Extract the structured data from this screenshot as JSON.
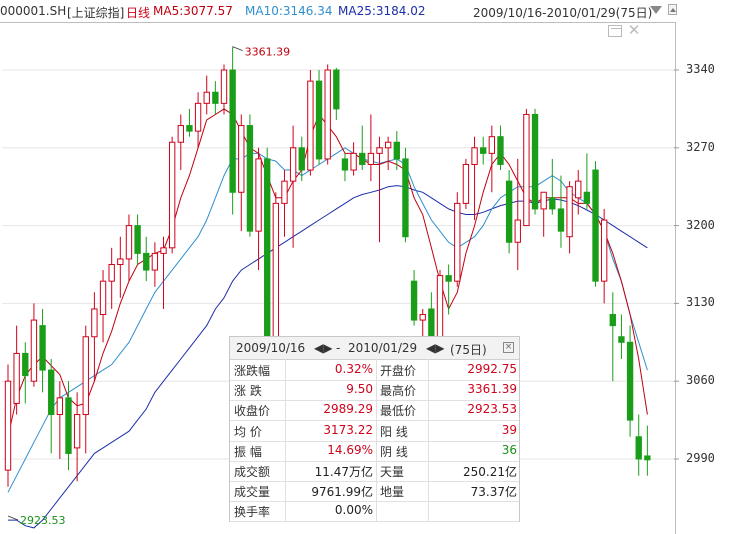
{
  "header": {
    "code": "000001.SH",
    "name": "[上证综指]",
    "period": "日线",
    "ma5": "MA5:3077.57",
    "ma10": "MA10:3146.34",
    "ma25": "MA25:3184.02",
    "range": "2009/10/16-2010/01/29(75日)"
  },
  "colors": {
    "up": "#d0021b",
    "down": "#1a9e1a",
    "ma5": "#c0000f",
    "ma10": "#2f8fd0",
    "ma25": "#1b2fa8"
  },
  "chart_data": {
    "type": "candlestick",
    "y_ticks": [
      "3340",
      "3270",
      "3200",
      "3130",
      "3060",
      "2990"
    ],
    "ylim": [
      2920,
      3365
    ],
    "grid": true,
    "annotations": {
      "high_label": "3361.39",
      "low_label": "2923.53"
    },
    "candles": [
      {
        "o": 2980,
        "h": 3075,
        "l": 2965,
        "c": 3060
      },
      {
        "o": 3040,
        "h": 3110,
        "l": 3030,
        "c": 3085
      },
      {
        "o": 3085,
        "h": 3095,
        "l": 3040,
        "c": 3065
      },
      {
        "o": 3060,
        "h": 3130,
        "l": 3055,
        "c": 3115
      },
      {
        "o": 3110,
        "h": 3125,
        "l": 3050,
        "c": 3070
      },
      {
        "o": 3070,
        "h": 3080,
        "l": 2995,
        "c": 3030
      },
      {
        "o": 3030,
        "h": 3060,
        "l": 2990,
        "c": 3045
      },
      {
        "o": 3045,
        "h": 3060,
        "l": 2980,
        "c": 2995
      },
      {
        "o": 3000,
        "h": 3050,
        "l": 2970,
        "c": 3030
      },
      {
        "o": 3030,
        "h": 3110,
        "l": 2995,
        "c": 3100
      },
      {
        "o": 3100,
        "h": 3140,
        "l": 3060,
        "c": 3125
      },
      {
        "o": 3120,
        "h": 3160,
        "l": 3095,
        "c": 3150
      },
      {
        "o": 3150,
        "h": 3180,
        "l": 3125,
        "c": 3165
      },
      {
        "o": 3165,
        "h": 3190,
        "l": 3135,
        "c": 3170
      },
      {
        "o": 3170,
        "h": 3210,
        "l": 3150,
        "c": 3200
      },
      {
        "o": 3200,
        "h": 3210,
        "l": 3165,
        "c": 3175
      },
      {
        "o": 3175,
        "h": 3190,
        "l": 3150,
        "c": 3160
      },
      {
        "o": 3160,
        "h": 3185,
        "l": 3145,
        "c": 3175
      },
      {
        "o": 3175,
        "h": 3190,
        "l": 3125,
        "c": 3180
      },
      {
        "o": 3180,
        "h": 3280,
        "l": 3175,
        "c": 3275
      },
      {
        "o": 3275,
        "h": 3300,
        "l": 3250,
        "c": 3290
      },
      {
        "o": 3290,
        "h": 3305,
        "l": 3280,
        "c": 3285
      },
      {
        "o": 3285,
        "h": 3320,
        "l": 3270,
        "c": 3310
      },
      {
        "o": 3310,
        "h": 3335,
        "l": 3300,
        "c": 3320
      },
      {
        "o": 3320,
        "h": 3330,
        "l": 3300,
        "c": 3310
      },
      {
        "o": 3310,
        "h": 3345,
        "l": 3300,
        "c": 3340
      },
      {
        "o": 3340,
        "h": 3361,
        "l": 3210,
        "c": 3230
      },
      {
        "o": 3230,
        "h": 3300,
        "l": 3195,
        "c": 3290
      },
      {
        "o": 3290,
        "h": 3300,
        "l": 3190,
        "c": 3195
      },
      {
        "o": 3195,
        "h": 3270,
        "l": 3160,
        "c": 3260
      },
      {
        "o": 3260,
        "h": 3270,
        "l": 3080,
        "c": 3100
      },
      {
        "o": 3100,
        "h": 3230,
        "l": 3095,
        "c": 3220
      },
      {
        "o": 3220,
        "h": 3250,
        "l": 3190,
        "c": 3240
      },
      {
        "o": 3240,
        "h": 3290,
        "l": 3180,
        "c": 3270
      },
      {
        "o": 3270,
        "h": 3280,
        "l": 3240,
        "c": 3250
      },
      {
        "o": 3250,
        "h": 3340,
        "l": 3245,
        "c": 3330
      },
      {
        "o": 3330,
        "h": 3340,
        "l": 3255,
        "c": 3260
      },
      {
        "o": 3260,
        "h": 3345,
        "l": 3255,
        "c": 3340
      },
      {
        "o": 3340,
        "h": 3342,
        "l": 3295,
        "c": 3305
      },
      {
        "o": 3260,
        "h": 3265,
        "l": 3240,
        "c": 3250
      },
      {
        "o": 3250,
        "h": 3275,
        "l": 3245,
        "c": 3265
      },
      {
        "o": 3265,
        "h": 3290,
        "l": 3250,
        "c": 3255
      },
      {
        "o": 3255,
        "h": 3300,
        "l": 3240,
        "c": 3265
      },
      {
        "o": 3265,
        "h": 3280,
        "l": 3185,
        "c": 3270
      },
      {
        "o": 3270,
        "h": 3280,
        "l": 3250,
        "c": 3275
      },
      {
        "o": 3275,
        "h": 3285,
        "l": 3250,
        "c": 3260
      },
      {
        "o": 3260,
        "h": 3270,
        "l": 3185,
        "c": 3190
      },
      {
        "o": 3150,
        "h": 3160,
        "l": 3110,
        "c": 3115
      },
      {
        "o": 3115,
        "h": 3125,
        "l": 3065,
        "c": 3120
      },
      {
        "o": 3125,
        "h": 3140,
        "l": 3045,
        "c": 3075
      },
      {
        "o": 3085,
        "h": 3160,
        "l": 3080,
        "c": 3155
      },
      {
        "o": 3155,
        "h": 3165,
        "l": 3120,
        "c": 3150
      },
      {
        "o": 3150,
        "h": 3230,
        "l": 3145,
        "c": 3220
      },
      {
        "o": 3220,
        "h": 3260,
        "l": 3215,
        "c": 3255
      },
      {
        "o": 3255,
        "h": 3280,
        "l": 3205,
        "c": 3270
      },
      {
        "o": 3270,
        "h": 3280,
        "l": 3255,
        "c": 3265
      },
      {
        "o": 3265,
        "h": 3290,
        "l": 3230,
        "c": 3280
      },
      {
        "o": 3280,
        "h": 3290,
        "l": 3250,
        "c": 3255
      },
      {
        "o": 3240,
        "h": 3250,
        "l": 3175,
        "c": 3185
      },
      {
        "o": 3185,
        "h": 3260,
        "l": 3160,
        "c": 3205
      },
      {
        "o": 3200,
        "h": 3305,
        "l": 3200,
        "c": 3300
      },
      {
        "o": 3300,
        "h": 3305,
        "l": 3210,
        "c": 3215
      },
      {
        "o": 3215,
        "h": 3230,
        "l": 3190,
        "c": 3230
      },
      {
        "o": 3225,
        "h": 3260,
        "l": 3210,
        "c": 3215
      },
      {
        "o": 3215,
        "h": 3245,
        "l": 3180,
        "c": 3195
      },
      {
        "o": 3190,
        "h": 3240,
        "l": 3175,
        "c": 3235
      },
      {
        "o": 3225,
        "h": 3250,
        "l": 3210,
        "c": 3240
      },
      {
        "o": 3230,
        "h": 3265,
        "l": 3215,
        "c": 3220
      },
      {
        "o": 3250,
        "h": 3258,
        "l": 3145,
        "c": 3150
      },
      {
        "o": 3150,
        "h": 3215,
        "l": 3130,
        "c": 3205
      },
      {
        "o": 3120,
        "h": 3140,
        "l": 3060,
        "c": 3110
      },
      {
        "o": 3100,
        "h": 3120,
        "l": 3080,
        "c": 3095
      },
      {
        "o": 3095,
        "h": 3110,
        "l": 3010,
        "c": 3025
      },
      {
        "o": 3010,
        "h": 3030,
        "l": 2975,
        "c": 2990
      },
      {
        "o": 2992.75,
        "h": 3020,
        "l": 2975,
        "c": 2989.29
      }
    ],
    "ma5": [
      3010,
      3045,
      3065,
      3075,
      3082,
      3074,
      3066,
      3045,
      3038,
      3040,
      3060,
      3085,
      3105,
      3130,
      3150,
      3165,
      3170,
      3175,
      3178,
      3198,
      3225,
      3245,
      3270,
      3295,
      3300,
      3305,
      3300,
      3285,
      3270,
      3265,
      3245,
      3225,
      3225,
      3240,
      3250,
      3280,
      3300,
      3290,
      3280,
      3265,
      3265,
      3260,
      3255,
      3255,
      3258,
      3255,
      3250,
      3225,
      3210,
      3180,
      3150,
      3125,
      3140,
      3175,
      3200,
      3230,
      3255,
      3265,
      3255,
      3240,
      3225,
      3220,
      3225,
      3225,
      3225,
      3225,
      3220,
      3220,
      3210,
      3195,
      3175,
      3150,
      3120,
      3080,
      3030
    ],
    "ma10": [
      2960,
      2975,
      2990,
      3005,
      3020,
      3035,
      3045,
      3050,
      3055,
      3060,
      3065,
      3070,
      3075,
      3085,
      3095,
      3110,
      3125,
      3140,
      3150,
      3160,
      3170,
      3180,
      3190,
      3205,
      3225,
      3245,
      3260,
      3260,
      3265,
      3265,
      3260,
      3258,
      3250,
      3250,
      3245,
      3250,
      3255,
      3260,
      3265,
      3270,
      3265,
      3260,
      3258,
      3256,
      3258,
      3260,
      3255,
      3235,
      3220,
      3205,
      3195,
      3185,
      3180,
      3185,
      3190,
      3200,
      3215,
      3225,
      3230,
      3235,
      3235,
      3235,
      3240,
      3245,
      3240,
      3230,
      3225,
      3220,
      3210,
      3195,
      3170,
      3150,
      3120,
      3095,
      3070
    ],
    "ma25": [
      2935,
      2935,
      2930,
      2928,
      2935,
      2945,
      2955,
      2965,
      2975,
      2985,
      2995,
      3000,
      3005,
      3010,
      3015,
      3025,
      3035,
      3050,
      3060,
      3070,
      3080,
      3090,
      3100,
      3110,
      3125,
      3135,
      3150,
      3160,
      3165,
      3170,
      3175,
      3180,
      3185,
      3190,
      3195,
      3200,
      3205,
      3210,
      3215,
      3220,
      3225,
      3228,
      3230,
      3232,
      3235,
      3236,
      3235,
      3232,
      3230,
      3225,
      3220,
      3215,
      3212,
      3210,
      3210,
      3212,
      3215,
      3218,
      3220,
      3222,
      3222,
      3220,
      3222,
      3224,
      3223,
      3221,
      3218,
      3214,
      3210,
      3205,
      3200,
      3195,
      3190,
      3185,
      3180
    ]
  },
  "info_panel": {
    "range_start": "2009/10/16",
    "sep": "-",
    "range_end": "2010/01/29",
    "days": "(75日)",
    "rows": [
      {
        "l1": "涨跌幅",
        "v1": "0.32%",
        "l2": "开盘价",
        "v2": "2992.75"
      },
      {
        "l1": "涨  跌",
        "v1": "9.50",
        "l2": "最高价",
        "v2": "3361.39"
      },
      {
        "l1": "收盘价",
        "v1": "2989.29",
        "l2": "最低价",
        "v2": "2923.53"
      },
      {
        "l1": "均  价",
        "v1": "3173.22",
        "l2": "阳  线",
        "v2": "39"
      },
      {
        "l1": "振  幅",
        "v1": "14.69%",
        "l2": "阴  线",
        "v2": "36"
      },
      {
        "l1": "成交额",
        "v1": "11.47万亿",
        "l2": "天量",
        "v2": "250.21亿"
      },
      {
        "l1": "成交量",
        "v1": "9761.99亿",
        "l2": "地量",
        "v2": "73.37亿"
      },
      {
        "l1": "换手率",
        "v1": "0.00%",
        "l2": "",
        "v2": ""
      }
    ]
  }
}
